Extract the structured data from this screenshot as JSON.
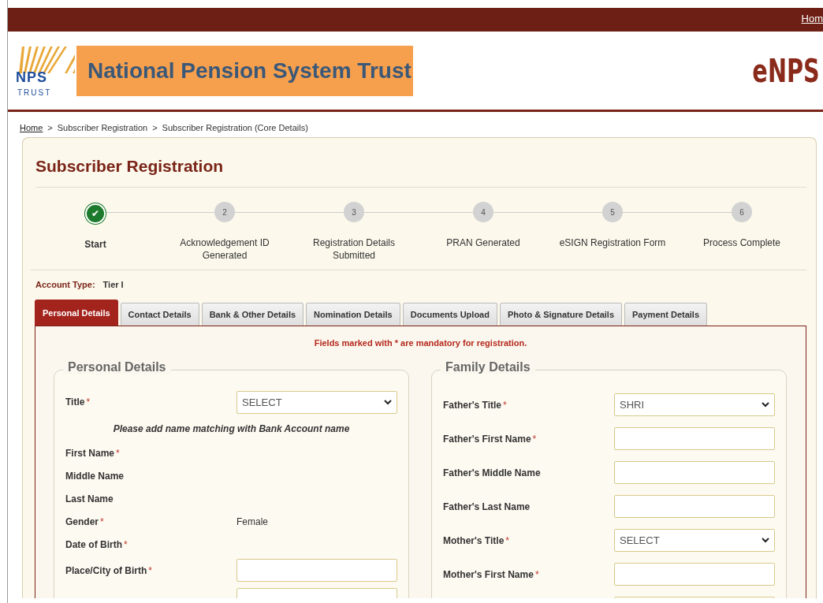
{
  "top_bar": {
    "link": "Hom"
  },
  "header": {
    "logo_main": "NPS",
    "logo_sub": "TRUST",
    "banner": "National Pension System Trust",
    "brand": "eNPS"
  },
  "breadcrumb": [
    {
      "label": "Home",
      "link": true
    },
    {
      "label": ">",
      "link": false
    },
    {
      "label": "Subscriber Registration",
      "link": false
    },
    {
      "label": ">",
      "link": false
    },
    {
      "label": "Subscriber Registration (Core Details)",
      "link": false
    }
  ],
  "title": "Subscriber Registration",
  "steps": [
    {
      "number": "✔",
      "label": "Start",
      "done": true
    },
    {
      "number": "2",
      "label": "Acknowledgement ID Generated",
      "done": false
    },
    {
      "number": "3",
      "label": "Registration Details Submitted",
      "done": false
    },
    {
      "number": "4",
      "label": "PRAN Generated",
      "done": false
    },
    {
      "number": "5",
      "label": "eSIGN Registration Form",
      "done": false
    },
    {
      "number": "6",
      "label": "Process Complete",
      "done": false
    }
  ],
  "account_type": {
    "label": "Account Type:",
    "value": "Tier I"
  },
  "tabs": [
    {
      "label": "Personal Details",
      "selected": true
    },
    {
      "label": "Contact Details",
      "selected": false
    },
    {
      "label": "Bank & Other Details",
      "selected": false
    },
    {
      "label": "Nomination Details",
      "selected": false
    },
    {
      "label": "Documents Upload",
      "selected": false
    },
    {
      "label": "Photo & Signature Details",
      "selected": false
    },
    {
      "label": "Payment Details",
      "selected": false
    }
  ],
  "mandatory_note": "Fields marked with * are mandatory for registration.",
  "sections": [
    {
      "legend": "Personal Details",
      "rows": [
        {
          "kind": "select",
          "label": "Title",
          "mark": "*",
          "value": "SELECT"
        },
        {
          "kind": "note",
          "text": "Please add name matching with Bank Account name"
        },
        {
          "kind": "label",
          "label": "First Name",
          "mark": "*"
        },
        {
          "kind": "label",
          "label": "Middle Name"
        },
        {
          "kind": "label",
          "label": "Last Name"
        },
        {
          "kind": "text",
          "label": "Gender",
          "mark": "*",
          "value": "Female"
        },
        {
          "kind": "label",
          "label": "Date of Birth",
          "mark": "*"
        },
        {
          "kind": "input",
          "label": "Place/City of Birth",
          "mark": "*"
        },
        {
          "kind": "input"
        }
      ]
    },
    {
      "legend": "Family Details",
      "rows": [
        {
          "kind": "select",
          "label": "Father's Title",
          "mark": "*",
          "value": "SHRI"
        },
        {
          "kind": "input",
          "label": "Father's First Name",
          "mark": "*"
        },
        {
          "kind": "input",
          "label": "Father's Middle Name"
        },
        {
          "kind": "input",
          "label": "Father's Last Name"
        },
        {
          "kind": "select",
          "label": "Mother's Title",
          "mark": "*",
          "value": "SELECT"
        },
        {
          "kind": "input",
          "label": "Mother's First Name",
          "mark": "*"
        },
        {
          "kind": "input"
        }
      ]
    }
  ]
}
